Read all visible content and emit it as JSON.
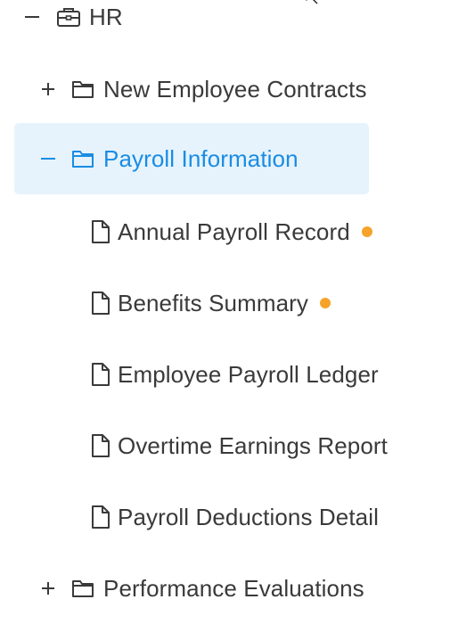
{
  "colors": {
    "text": "#3a3a3a",
    "selected_text": "#1a8ce3",
    "selected_background": "#e6f3fd",
    "modified_dot": "#f5a32a"
  },
  "tree": {
    "root": {
      "label": "HR",
      "state": "expanded",
      "icon": "briefcase-icon"
    },
    "children": [
      {
        "label": "New Employee Contracts",
        "state": "collapsed",
        "icon": "folder-icon"
      },
      {
        "label": "Payroll Information",
        "state": "expanded",
        "selected": true,
        "icon": "folder-icon",
        "files": [
          {
            "label": "Annual Payroll Record",
            "icon": "file-icon",
            "modified": true
          },
          {
            "label": "Benefits Summary",
            "icon": "file-icon",
            "modified": true
          },
          {
            "label": "Employee Payroll Ledger",
            "icon": "file-icon",
            "modified": false
          },
          {
            "label": "Overtime Earnings Report",
            "icon": "file-icon",
            "modified": false
          },
          {
            "label": "Payroll Deductions Detail",
            "icon": "file-icon",
            "modified": false
          }
        ]
      },
      {
        "label": "Performance Evaluations",
        "state": "collapsed",
        "icon": "folder-icon"
      }
    ]
  }
}
